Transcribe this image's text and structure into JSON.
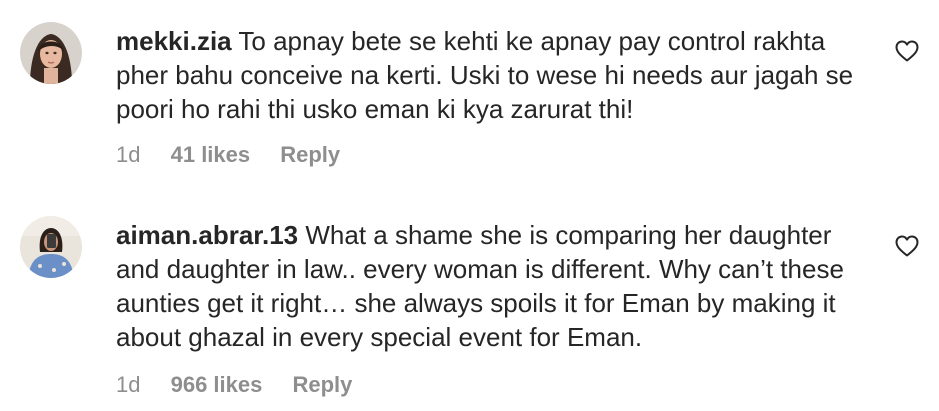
{
  "comments": [
    {
      "avatar": "user-avatar",
      "username": "mekki.zia",
      "text": "To apnay bete se kehti ke apnay pay control rakhta pher bahu conceive na kerti. Uski to wese hi needs aur jagah se poori ho rahi thi usko eman ki kya zarurat thi!",
      "time": "1d",
      "likes": "41 likes",
      "reply_label": "Reply",
      "like_icon": "heart-outline-icon"
    },
    {
      "avatar": "user-avatar",
      "username": "aiman.abrar.13",
      "text": "What a shame she is comparing her daughter and daughter in law.. every woman is different. Why can’t these aunties get it right… she always spoils it for Eman by making it about ghazal in every special event for Eman.",
      "time": "1d",
      "likes": "966 likes",
      "reply_label": "Reply",
      "like_icon": "heart-outline-icon"
    }
  ],
  "colors": {
    "primary_text": "#262626",
    "secondary_text": "#8e8e8e",
    "background": "#ffffff"
  }
}
